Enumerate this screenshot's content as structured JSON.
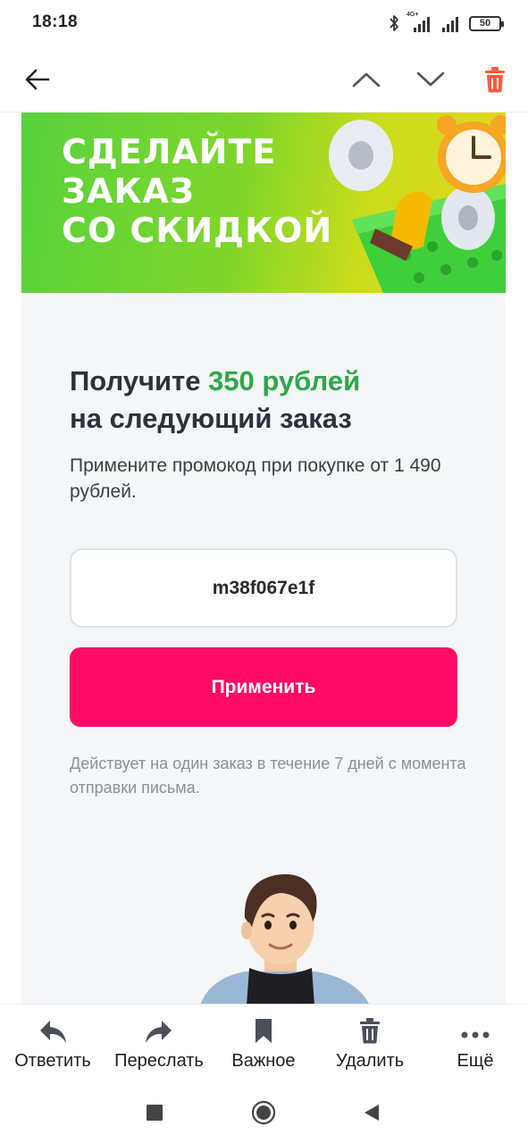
{
  "status_bar": {
    "time": "18:18",
    "network_label": "4G+",
    "battery_level": "50",
    "icons": [
      "bluetooth-icon",
      "signal-4g-icon",
      "signal-icon",
      "battery-icon"
    ]
  },
  "toolbar": {
    "icons": [
      "back-arrow-icon",
      "chevron-up-icon",
      "chevron-down-icon",
      "trash-icon"
    ],
    "delete_color": "#ff5a3c"
  },
  "banner": {
    "lines": [
      "СДЕЛАЙТЕ",
      "ЗАКАЗ",
      "СО СКИДКОЙ"
    ]
  },
  "email": {
    "headline_prefix": "Получите ",
    "headline_accent": "350 рублей",
    "headline_line2": "на следующий заказ",
    "subtext": "Примените промокод при покупке от 1 490 рублей.",
    "promo_code": "m38f067e1f",
    "apply_label": "Применить",
    "validity": "Действует на один заказ в течение 7 дней с момента отправки письма."
  },
  "actions": [
    {
      "label": "Ответить",
      "icon": "reply-icon"
    },
    {
      "label": "Переслать",
      "icon": "forward-icon"
    },
    {
      "label": "Важное",
      "icon": "bookmark-icon"
    },
    {
      "label": "Удалить",
      "icon": "trash-icon"
    },
    {
      "label": "Ещё",
      "icon": "more-dots-icon"
    }
  ],
  "nav": {
    "icons": [
      "recents-square-icon",
      "home-circle-icon",
      "back-triangle-icon"
    ]
  },
  "colors": {
    "accent_green": "#2ea84a",
    "apply_button": "#ff0a64",
    "background": "#f4f6f8"
  }
}
